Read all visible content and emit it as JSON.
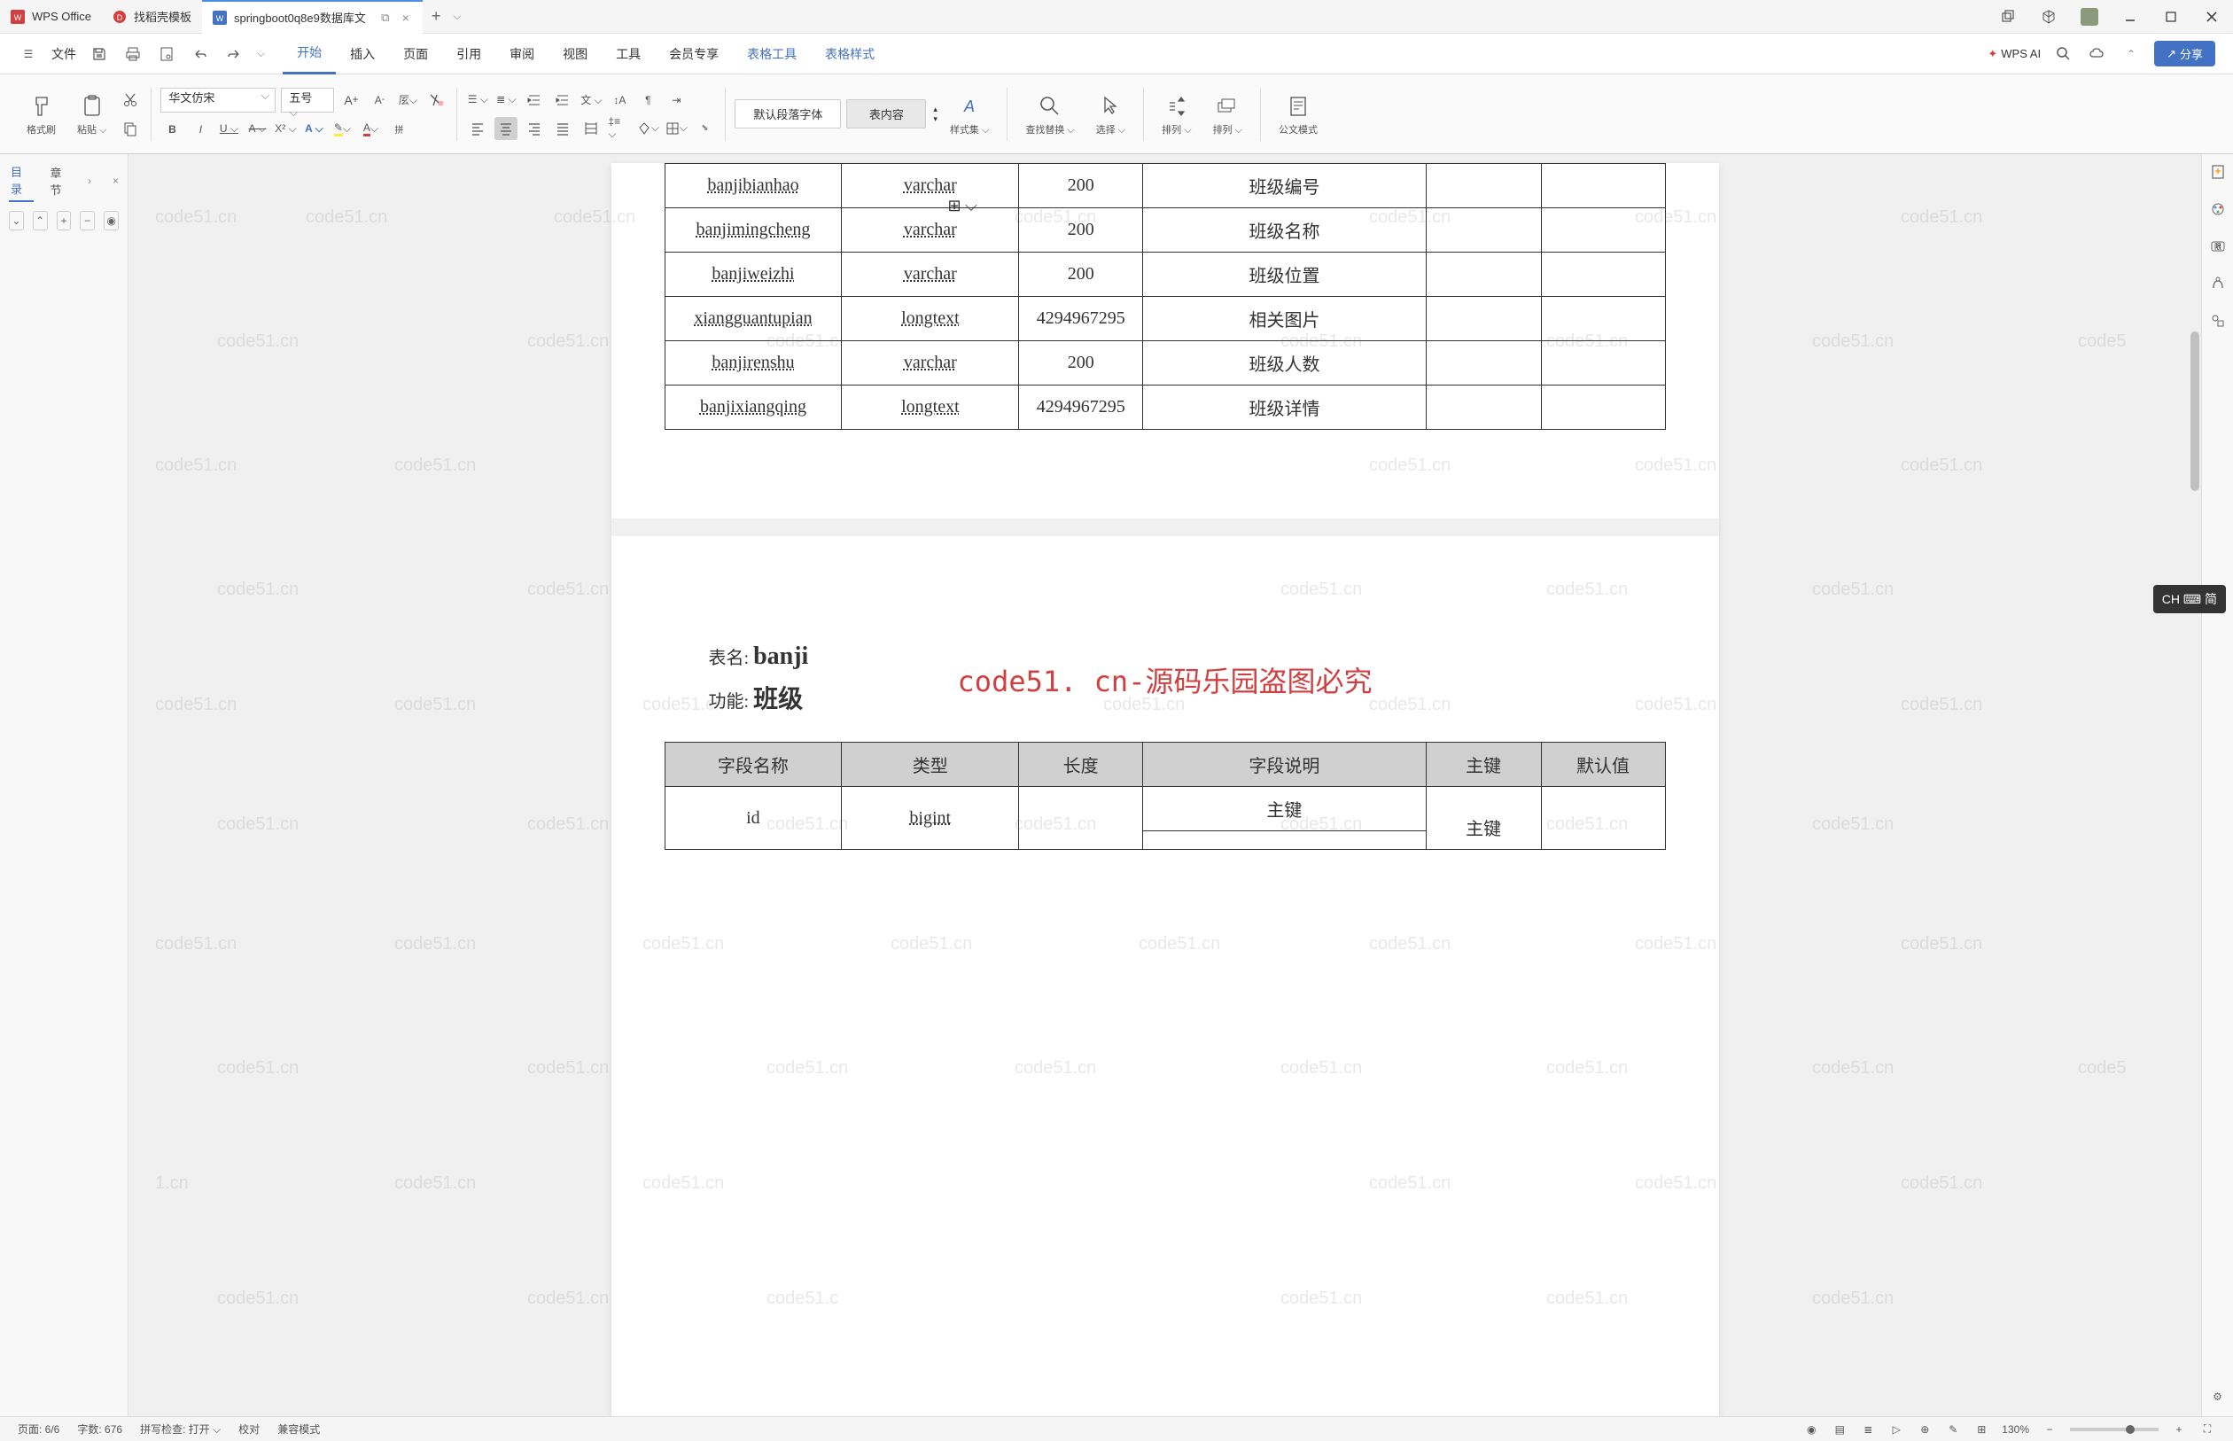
{
  "titlebar": {
    "tabs": [
      {
        "label": "WPS Office",
        "icon_color": "#d04040"
      },
      {
        "label": "找稻壳模板",
        "icon_color": "#d04040"
      },
      {
        "label": "springboot0q8e9数据库文",
        "icon_color": "#4372c4"
      }
    ]
  },
  "menubar": {
    "file": "文件",
    "tabs": [
      "开始",
      "插入",
      "页面",
      "引用",
      "审阅",
      "视图",
      "工具",
      "会员专享",
      "表格工具",
      "表格样式"
    ],
    "wps_ai": "WPS AI",
    "share": "分享"
  },
  "ribbon": {
    "format_brush": "格式刷",
    "paste": "粘贴",
    "font_name": "华文仿宋",
    "font_size": "五号",
    "default_para": "默认段落字体",
    "table_content": "表内容",
    "style_set": "样式集",
    "find_replace": "查找替换",
    "select": "选择",
    "arrange": "排列",
    "sort": "排列",
    "fullscreen": "公文模式"
  },
  "sidebar": {
    "toc": "目录",
    "chapter": "章节"
  },
  "document": {
    "table1": {
      "rows": [
        {
          "field": "banjibianhao",
          "type": "varchar",
          "length": "200",
          "desc": "班级编号",
          "pk": "",
          "default": ""
        },
        {
          "field": "banjimingcheng",
          "type": "varchar",
          "length": "200",
          "desc": "班级名称",
          "pk": "",
          "default": ""
        },
        {
          "field": "banjiweizhi",
          "type": "varchar",
          "length": "200",
          "desc": "班级位置",
          "pk": "",
          "default": ""
        },
        {
          "field": "xiangguantupian",
          "type": "longtext",
          "length": "4294967295",
          "desc": "相关图片",
          "pk": "",
          "default": ""
        },
        {
          "field": "banjirenshu",
          "type": "varchar",
          "length": "200",
          "desc": "班级人数",
          "pk": "",
          "default": ""
        },
        {
          "field": "banjixiangqing",
          "type": "longtext",
          "length": "4294967295",
          "desc": "班级详情",
          "pk": "",
          "default": ""
        }
      ]
    },
    "table2_name_label": "表名:",
    "table2_name": "banji",
    "table2_func_label": "功能:",
    "table2_func": "班级",
    "table2": {
      "headers": [
        "字段名称",
        "类型",
        "长度",
        "字段说明",
        "主键",
        "默认值"
      ],
      "rows": [
        {
          "field": "id",
          "type": "bigint",
          "length": "",
          "desc": "主键",
          "pk": "主键",
          "default": ""
        }
      ]
    },
    "watermark_text": "code51. cn-源码乐园盗图必究"
  },
  "statusbar": {
    "page": "页面: 6/6",
    "words": "字数: 676",
    "spell": "拼写检查: 打开",
    "proof": "校对",
    "compat": "兼容模式",
    "zoom": "130%"
  },
  "ime": "CH ⌨ 简"
}
